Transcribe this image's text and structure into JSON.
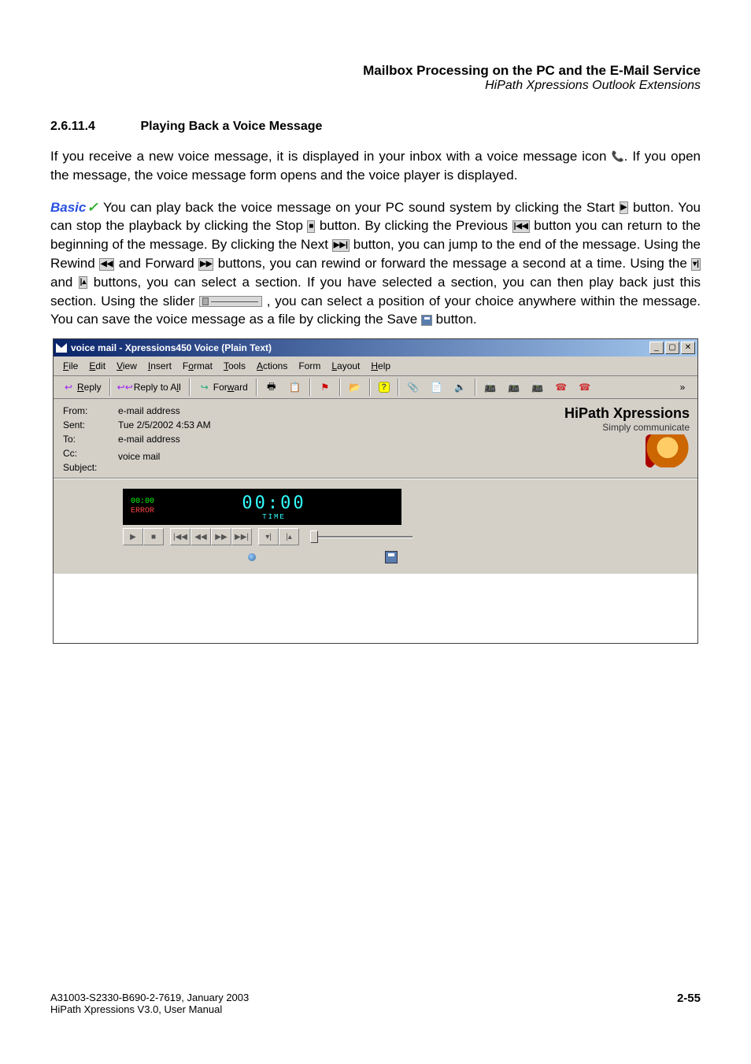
{
  "header": {
    "line1": "Mailbox Processing on the PC and the E-Mail Service",
    "line2": "HiPath Xpressions Outlook Extensions"
  },
  "section": {
    "number": "2.6.11.4",
    "title": "Playing Back a Voice Message"
  },
  "paragraphs": {
    "p1a": "If you receive a new voice message, it is displayed in your inbox with a voice message icon ",
    "p1b": ". If you open the message, the voice message form opens and the voice player is displayed.",
    "basic": "Basic",
    "p2a": " You can play back the voice message on your PC sound system by clicking the Start ",
    "p2b": " button. You can stop the playback by clicking the Stop ",
    "p2c": " button. By clicking the Previous ",
    "p2d": " button you can return to the beginning of the message. By clicking the Next ",
    "p2e": " button, you can jump to the end of the message. Using the Rewind ",
    "p2f": " and Forward ",
    "p2g": " buttons, you can rewind or forward the message a second at a time. Using the ",
    "p2h": " and ",
    "p2i": " buttons, you can select a section. If you have selected a section, you can then play back just this section. Using the slider ",
    "p2j": ", you can select a position of your choice anywhere within the message. You can save the voice message as a file by clicking the Save ",
    "p2k": " button."
  },
  "window": {
    "title": "voice mail - Xpressions450 Voice (Plain Text)",
    "menu": {
      "file": "File",
      "edit": "Edit",
      "view": "View",
      "insert": "Insert",
      "format": "Format",
      "tools": "Tools",
      "actions": "Actions",
      "form": "Form",
      "layout": "Layout",
      "help": "Help"
    },
    "toolbar": {
      "reply": "Reply",
      "reply_all": "Reply to All",
      "forward": "Forward"
    },
    "header_labels": {
      "from": "From:",
      "sent": "Sent:",
      "to": "To:",
      "cc": "Cc:",
      "subject": "Subject:"
    },
    "header_values": {
      "from": "e-mail address",
      "sent": "Tue 2/5/2002 4:53 AM",
      "to": "e-mail address",
      "cc": "",
      "subject": "voice mail"
    },
    "brand": {
      "line1": "HiPath Xpressions",
      "line2": "Simply communicate"
    },
    "player": {
      "elapsed": "00:00",
      "status": "ERROR",
      "time_big": "00:00",
      "time_label": "TIME"
    }
  },
  "footer": {
    "line1": "A31003-S2330-B690-2-7619, January 2003",
    "line2": "HiPath Xpressions V3.0, User Manual",
    "page": "2-55"
  }
}
